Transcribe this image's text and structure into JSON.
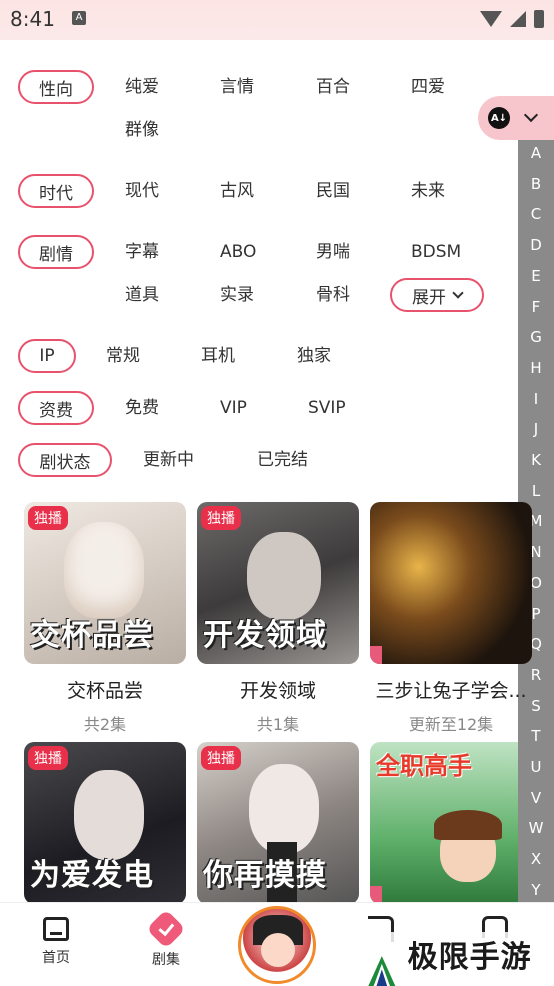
{
  "status": {
    "time": "8:41"
  },
  "filters": {
    "orientation": {
      "label": "性向",
      "options": [
        "纯爱",
        "言情",
        "百合",
        "四爱",
        "群像"
      ]
    },
    "era": {
      "label": "时代",
      "options": [
        "现代",
        "古风",
        "民国",
        "未来"
      ]
    },
    "plot": {
      "label": "剧情",
      "options": [
        "字幕",
        "ABO",
        "男喘",
        "BDSM",
        "道具",
        "实录",
        "骨科"
      ],
      "expand": "展开"
    },
    "ip": {
      "label": "IP",
      "options": [
        "常规",
        "耳机",
        "独家"
      ]
    },
    "fee": {
      "label": "资费",
      "options": [
        "免费",
        "VIP",
        "SVIP"
      ]
    },
    "status": {
      "label": "剧状态",
      "options": [
        "更新中",
        "已完结"
      ]
    }
  },
  "alphabet": [
    "A",
    "B",
    "C",
    "D",
    "E",
    "F",
    "G",
    "H",
    "I",
    "J",
    "K",
    "L",
    "M",
    "N",
    "O",
    "P",
    "Q",
    "R",
    "S",
    "T",
    "U",
    "V",
    "W",
    "X",
    "Y"
  ],
  "cards": [
    {
      "badge": "独播",
      "cover_text": "交杯品尝",
      "name": "交杯品尝",
      "sub": "共2集"
    },
    {
      "badge": "独播",
      "cover_text": "开发领域",
      "name": "开发领域",
      "sub": "共1集"
    },
    {
      "badge": "",
      "cover_text": "",
      "name": "三步让兔子学会...",
      "sub": "更新至12集"
    },
    {
      "badge": "独播",
      "cover_text": "为爱发电",
      "name": "",
      "sub": ""
    },
    {
      "badge": "独播",
      "cover_text": "你再摸摸",
      "name": "",
      "sub": ""
    },
    {
      "badge": "",
      "cover_text": "全职高手",
      "name": "",
      "sub": ""
    }
  ],
  "tabbar": {
    "home": "首页",
    "drama": "剧集"
  },
  "watermark": "极限手游网",
  "colors": {
    "accent": "#e8526d",
    "badge": "#e8304a",
    "alpha_bar": "#8a8a8a",
    "sort_pill": "#f7c6cc"
  }
}
